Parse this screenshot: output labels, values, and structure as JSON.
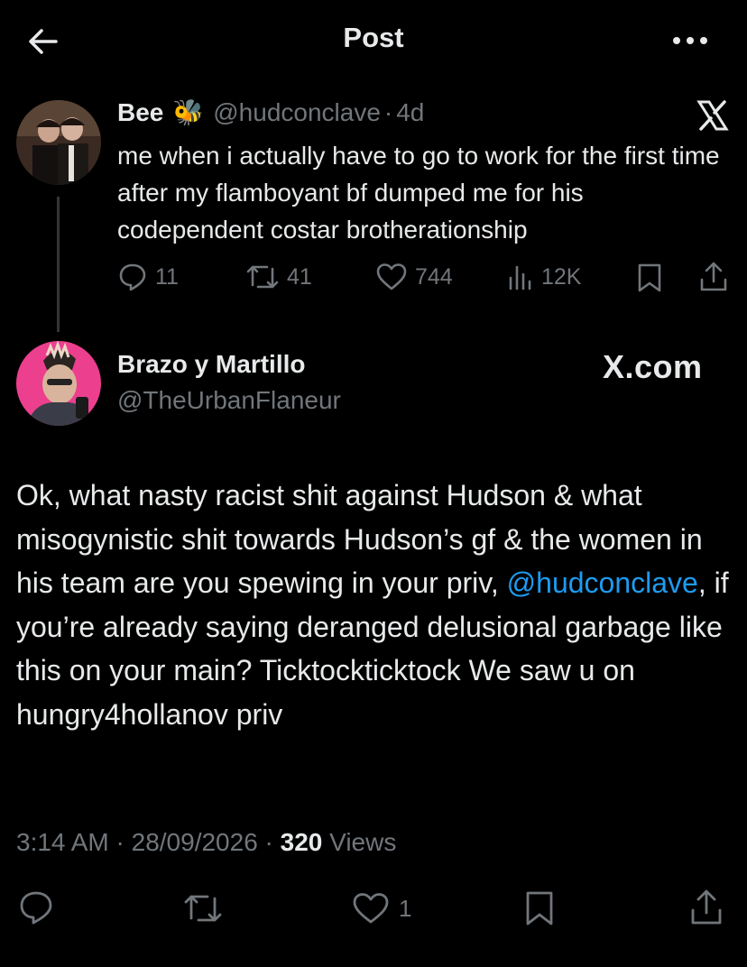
{
  "header": {
    "title": "Post"
  },
  "quoted": {
    "name": "Bee",
    "name_emoji": "🐝",
    "handle": "@hudconclave",
    "separator": "·",
    "time": "4d",
    "text": "me when i actually have to go to work for the first time after my flamboyant bf dumped me for his codependent costar brotherationship",
    "stats": {
      "replies": "11",
      "reposts": "41",
      "likes": "744",
      "views": "12K"
    }
  },
  "post": {
    "name": "Brazo y Martillo",
    "handle": "@TheUrbanFlaneur",
    "watermark": "X.com",
    "text_part1": "Ok, what nasty racist shit against Hudson & what misogynistic shit towards Hudson’s gf & the women in his team are you spewing in your priv, ",
    "mention": "@hudconclave",
    "text_part2": ", if you’re already saying deranged delusional garbage like this on your main? Ticktockticktock We saw u on hungry4hollanov priv",
    "time": "3:14 AM",
    "sep": "·",
    "date": "28/09/2026",
    "views_count": "320",
    "views_label": "Views",
    "likes": "1"
  },
  "colors": {
    "background": "#000000",
    "text": "#e7e9ea",
    "muted": "#71767b",
    "accent": "#1d9bf0",
    "avatar_pink": "#ec3f8e"
  }
}
